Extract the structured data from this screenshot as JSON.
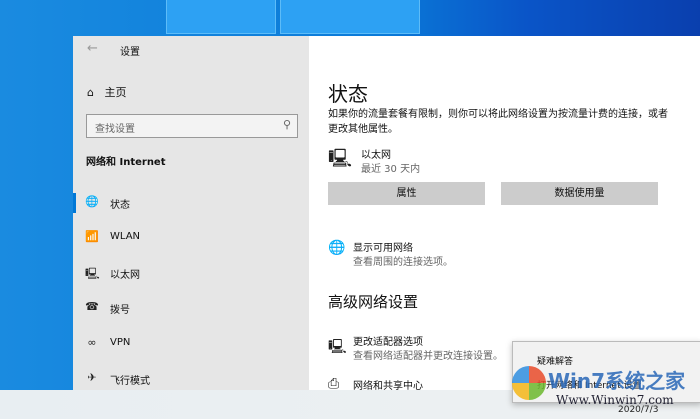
{
  "window": {
    "title": "设置",
    "back": "←"
  },
  "sidebar": {
    "home": "主页",
    "search_placeholder": "查找设置",
    "category": "网络和 Internet",
    "items": [
      {
        "label": "状态",
        "icon": "🌐"
      },
      {
        "label": "WLAN",
        "icon": "📶"
      },
      {
        "label": "以太网",
        "icon": "🖳"
      },
      {
        "label": "拨号",
        "icon": "☎"
      },
      {
        "label": "VPN",
        "icon": "∞"
      },
      {
        "label": "飞行模式",
        "icon": "✈"
      }
    ]
  },
  "main": {
    "title": "状态",
    "description": "如果你的流量套餐有限制，则你可以将此网络设置为按流量计费的连接，或者更改其他属性。",
    "connection": {
      "name": "以太网",
      "sub": "最近 30 天内"
    },
    "buttons": {
      "properties": "属性",
      "data_usage": "数据使用量"
    },
    "show_networks": {
      "title": "显示可用网络",
      "sub": "查看周围的连接选项。"
    },
    "advanced_title": "高级网络设置",
    "adapter": {
      "title": "更改适配器选项",
      "sub": "查看网络适配器并更改连接设置。"
    },
    "sharing": {
      "title": "网络和共享中心"
    }
  },
  "context_menu": {
    "items": [
      "疑难解答",
      "打开网络和 Internet 设置"
    ]
  },
  "watermark": {
    "brand": "Win7系统之家",
    "url": "Www.Winwin7.com"
  },
  "taskbar": {
    "date": "2020/7/3"
  }
}
